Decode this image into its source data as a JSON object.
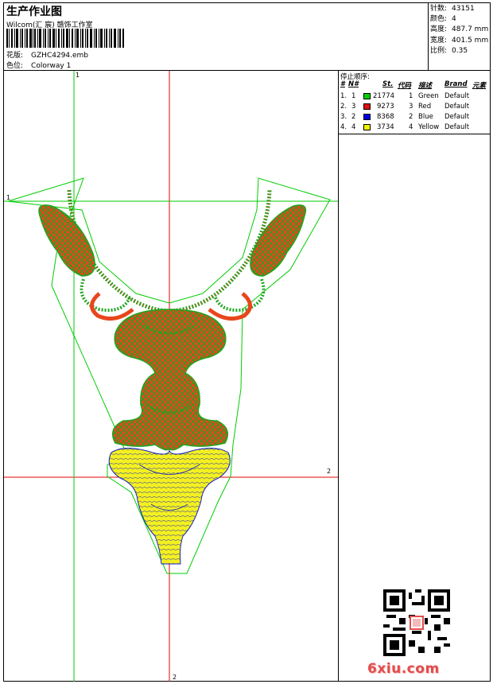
{
  "header": {
    "title": "生产作业图",
    "studio": "Wilcom(汇 宸) 赣饰工作室",
    "design_label": "花版:",
    "design_value": "GZHC4294.emb",
    "colorway_label": "色位:",
    "colorway_value": "Colorway 1"
  },
  "specs": [
    {
      "label": "针数:",
      "value": "43151"
    },
    {
      "label": "颜色:",
      "value": "4"
    },
    {
      "label": "高度:",
      "value": "487.7 mm"
    },
    {
      "label": "宽度:",
      "value": "401.5 mm"
    },
    {
      "label": "比例:",
      "value": "0.35"
    }
  ],
  "stops": {
    "title": "停止顺序:",
    "headers": {
      "num": "#",
      "n": "N#",
      "st": "St.",
      "code": "代码",
      "desc": "描述",
      "brand": "Brand",
      "elem": "元素"
    },
    "rows": [
      {
        "num": "1.",
        "n": "1",
        "color": "#00d000",
        "st": "21774",
        "code": "1",
        "desc": "Green",
        "brand": "Default"
      },
      {
        "num": "2.",
        "n": "3",
        "color": "#e01010",
        "st": "9273",
        "code": "3",
        "desc": "Red",
        "brand": "Default"
      },
      {
        "num": "3.",
        "n": "2",
        "color": "#0000e0",
        "st": "8368",
        "code": "2",
        "desc": "Blue",
        "brand": "Default"
      },
      {
        "num": "4.",
        "n": "4",
        "color": "#f0f000",
        "st": "3734",
        "code": "4",
        "desc": "Yellow",
        "brand": "Default"
      }
    ]
  },
  "guides": {
    "v_top": "1",
    "v_bottom": "2",
    "h_left": "1",
    "h_right": "2"
  },
  "watermark": "6xiu.com",
  "colors": {
    "guide_green": "#00cc00",
    "guide_red": "#ee0000",
    "thread_red": "#e8461c",
    "thread_green": "#1fa51f",
    "thread_yellow": "#f4f020",
    "thread_blue": "#1020c0"
  }
}
